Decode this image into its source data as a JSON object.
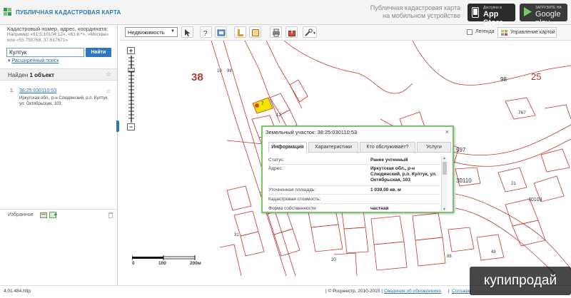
{
  "header": {
    "logo_text": "ПУБЛИЧНАЯ КАДАСТРОВАЯ КАРТА",
    "mobile_line1": "Публичная кадастровая карта",
    "mobile_line2": "на мобильном устройстве",
    "appstore_small": "Доступно в",
    "appstore_big": "App Store",
    "gplay_small": "ЗАГРУЗИТЕ НА",
    "gplay_big": "Google play"
  },
  "search": {
    "label": "Кадастровый номер, адрес, координата:",
    "hint": "Например «61:5:10104:12», «61:6:*», «Москва» или «55.755768, 37.617671»",
    "value": "Култук",
    "button": "Найти",
    "advanced": "Расширенный поиск"
  },
  "results": {
    "found_prefix": "Найден",
    "found_count": "1 объект",
    "item_number": "1.",
    "item_cadastral": "38:25:030110:53",
    "item_address": "Иркутская обл., р-н Слюдянский, р.п. Култук, ул. Октябрьская, 103"
  },
  "favorites": {
    "label": "Избранное"
  },
  "toolbar": {
    "layer_select": "Недвижимость",
    "legend_label": "Легенда",
    "map_management": "Управление картой"
  },
  "map": {
    "labels": {
      "block38": "38",
      "n10": "10",
      "n98a": "98",
      "n98b": "98",
      "n25": "25",
      "n767": "767",
      "n597": "597",
      "n30110": "30110",
      "n30103": "30103",
      "n7": "7",
      "n12": "12",
      "n21": "21",
      "n49": "49",
      "n88": "88",
      "n20": "20",
      "n31": "31"
    },
    "scale": {
      "s0": "0",
      "s1": "100",
      "s2": "200м"
    }
  },
  "popup": {
    "title": "Земельный участок: 38:25:030110:53",
    "tabs": [
      "Информация",
      "Характеристики",
      "Кто обслуживает?",
      "Услуги"
    ],
    "rows": [
      {
        "label": "Статус:",
        "value": "Ранее учтенный"
      },
      {
        "label": "Адрес:",
        "value": "Иркутская обл., р-н Слюдянский, р.п. Култук, ул. Октябрьская, 103"
      },
      {
        "label": "Уточненная площадь:",
        "value": "1 039.00 кв. м"
      },
      {
        "label": "Кадастровая стоимость:",
        "value": ""
      },
      {
        "label": "Форма собственности:",
        "value": "частная"
      }
    ]
  },
  "status": {
    "left": "4.01.484.http",
    "copyright": "| © Росреестр, 2010-2015 |",
    "link1": "Сведения об обновлениях",
    "sep": "|",
    "link2": "Соглаше"
  },
  "watermark": "купипродай",
  "colors": {
    "accent": "#2f77bf",
    "parcel_line": "#c0392b",
    "popup_border": "#7cc36e",
    "highlight": "#f2e600"
  }
}
